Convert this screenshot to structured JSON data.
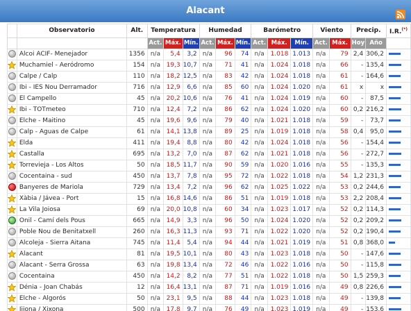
{
  "title": "Alacant",
  "headers": {
    "observatorio": "Observatorio",
    "alt": "Alt.",
    "temperatura": "Temperatura",
    "humedad": "Humedad",
    "barometro": "Barómetro",
    "viento": "Viento",
    "precip": "Precip.",
    "ir": "I.R.",
    "ir_sup": "(*)",
    "act": "Act.",
    "max": "Máx.",
    "min": "Mín.",
    "hoy": "Hoy",
    "ano": "Año"
  },
  "colors": {
    "max": "#d21f1f",
    "min": "#1f3fb5",
    "bar": "#2f66c8",
    "header": "#3a79c4"
  },
  "rows": [
    {
      "icon": "gray",
      "name": "Alcoi ACIF- Menejador",
      "alt": "1356",
      "t_act": "n/a",
      "t_max": "5,4",
      "t_min": "3,2",
      "h_act": "n/a",
      "h_max": "96",
      "h_min": "74",
      "b_act": "n/a",
      "b_max": "1.018",
      "b_min": "1.013",
      "v_act": "n/a",
      "v_max": "79",
      "p_hoy": "2,4",
      "p_ano": "306,2",
      "ir": 0.55
    },
    {
      "icon": "star",
      "name": "Muchamiel - Aeródromo",
      "alt": "154",
      "t_act": "n/a",
      "t_max": "19,3",
      "t_min": "10,7",
      "h_act": "n/a",
      "h_max": "71",
      "h_min": "41",
      "b_act": "n/a",
      "b_max": "1.024",
      "b_min": "1.018",
      "v_act": "n/a",
      "v_max": "66",
      "p_hoy": "-",
      "p_ano": "135,4",
      "ir": 0.6
    },
    {
      "icon": "gray",
      "name": "Calpe / Calp",
      "alt": "110",
      "t_act": "n/a",
      "t_max": "18,2",
      "t_min": "12,5",
      "h_act": "n/a",
      "h_max": "83",
      "h_min": "42",
      "b_act": "n/a",
      "b_max": "1.024",
      "b_min": "1.018",
      "v_act": "n/a",
      "v_max": "61",
      "p_hoy": "-",
      "p_ano": "164,6",
      "ir": 0.55
    },
    {
      "icon": "gray",
      "name": "Ibi - IES Nou Derramador",
      "alt": "716",
      "t_act": "n/a",
      "t_max": "12,9",
      "t_min": "6,6",
      "h_act": "n/a",
      "h_max": "85",
      "h_min": "60",
      "b_act": "n/a",
      "b_max": "1.024",
      "b_min": "1.020",
      "v_act": "n/a",
      "v_max": "61",
      "p_hoy": "x",
      "p_ano": "x",
      "ir": 0.6
    },
    {
      "icon": "gray",
      "name": "El Campello",
      "alt": "45",
      "t_act": "n/a",
      "t_max": "20,2",
      "t_min": "10,6",
      "h_act": "n/a",
      "h_max": "76",
      "h_min": "41",
      "b_act": "n/a",
      "b_max": "1.024",
      "b_min": "1.019",
      "v_act": "n/a",
      "v_max": "60",
      "p_hoy": "-",
      "p_ano": "87,5",
      "ir": 0.55
    },
    {
      "icon": "star",
      "name": "Ibi - TOTmeteo",
      "alt": "710",
      "t_act": "n/a",
      "t_max": "12,4",
      "t_min": "7,2",
      "h_act": "n/a",
      "h_max": "86",
      "h_min": "62",
      "b_act": "n/a",
      "b_max": "1.024",
      "b_min": "1.020",
      "v_act": "n/a",
      "v_max": "60",
      "p_hoy": "0,2",
      "p_ano": "216,2",
      "ir": 0.6
    },
    {
      "icon": "gray",
      "name": "Elche - Maitino",
      "alt": "45",
      "t_act": "n/a",
      "t_max": "19,6",
      "t_min": "9,6",
      "h_act": "n/a",
      "h_max": "79",
      "h_min": "40",
      "b_act": "n/a",
      "b_max": "1.021",
      "b_min": "1.018",
      "v_act": "n/a",
      "v_max": "59",
      "p_hoy": "-",
      "p_ano": "73,7",
      "ir": 0.55
    },
    {
      "icon": "gray",
      "name": "Calp - Aguas de Calpe",
      "alt": "61",
      "t_act": "n/a",
      "t_max": "14,1",
      "t_min": "13,8",
      "h_act": "n/a",
      "h_max": "89",
      "h_min": "25",
      "b_act": "n/a",
      "b_max": "1.019",
      "b_min": "1.018",
      "v_act": "n/a",
      "v_max": "58",
      "p_hoy": "0,4",
      "p_ano": "95,0",
      "ir": 0.6
    },
    {
      "icon": "star",
      "name": "Elda",
      "alt": "411",
      "t_act": "n/a",
      "t_max": "19,4",
      "t_min": "8,8",
      "h_act": "n/a",
      "h_max": "80",
      "h_min": "42",
      "b_act": "n/a",
      "b_max": "1.024",
      "b_min": "1.018",
      "v_act": "n/a",
      "v_max": "56",
      "p_hoy": "-",
      "p_ano": "154,4",
      "ir": 0.55
    },
    {
      "icon": "star",
      "name": "Castalla",
      "alt": "695",
      "t_act": "n/a",
      "t_max": "13,2",
      "t_min": "7,0",
      "h_act": "n/a",
      "h_max": "87",
      "h_min": "62",
      "b_act": "n/a",
      "b_max": "1.021",
      "b_min": "1.018",
      "v_act": "n/a",
      "v_max": "56",
      "p_hoy": "-",
      "p_ano": "272,7",
      "ir": 0.6
    },
    {
      "icon": "star",
      "name": "Torrevieja - Los Altos",
      "alt": "50",
      "t_act": "n/a",
      "t_max": "18,5",
      "t_min": "11,7",
      "h_act": "n/a",
      "h_max": "90",
      "h_min": "59",
      "b_act": "n/a",
      "b_max": "1.020",
      "b_min": "1.016",
      "v_act": "n/a",
      "v_max": "55",
      "p_hoy": "-",
      "p_ano": "135,3",
      "ir": 0.55
    },
    {
      "icon": "gray",
      "name": "Cocentaina - sud",
      "alt": "450",
      "t_act": "n/a",
      "t_max": "13,7",
      "t_min": "7,8",
      "h_act": "n/a",
      "h_max": "95",
      "h_min": "72",
      "b_act": "n/a",
      "b_max": "1.022",
      "b_min": "1.018",
      "v_act": "n/a",
      "v_max": "54",
      "p_hoy": "1,2",
      "p_ano": "231,3",
      "ir": 0.6
    },
    {
      "icon": "red",
      "name": "Banyeres de Mariola",
      "alt": "729",
      "t_act": "n/a",
      "t_max": "13,4",
      "t_min": "7,2",
      "h_act": "n/a",
      "h_max": "96",
      "h_min": "62",
      "b_act": "n/a",
      "b_max": "1.025",
      "b_min": "1.022",
      "v_act": "n/a",
      "v_max": "53",
      "p_hoy": "0,2",
      "p_ano": "244,6",
      "ir": 0.55
    },
    {
      "icon": "star",
      "name": "Xàbia / Jávea - Port",
      "alt": "15",
      "t_act": "n/a",
      "t_max": "16,8",
      "t_min": "14,6",
      "h_act": "n/a",
      "h_max": "86",
      "h_min": "51",
      "b_act": "n/a",
      "b_max": "1.019",
      "b_min": "1.018",
      "v_act": "n/a",
      "v_max": "53",
      "p_hoy": "2,2",
      "p_ano": "208,4",
      "ir": 0.6
    },
    {
      "icon": "star",
      "name": "La Vila Joiosa",
      "alt": "69",
      "t_act": "n/a",
      "t_max": "20,0",
      "t_min": "10,8",
      "h_act": "n/a",
      "h_max": "60",
      "h_min": "34",
      "b_act": "n/a",
      "b_max": "1.023",
      "b_min": "1.017",
      "v_act": "n/a",
      "v_max": "52",
      "p_hoy": "0,2",
      "p_ano": "114,3",
      "ir": 0.55
    },
    {
      "icon": "green",
      "name": "Onil - Camí dels Pous",
      "alt": "665",
      "t_act": "n/a",
      "t_max": "14,9",
      "t_min": "3,3",
      "h_act": "n/a",
      "h_max": "96",
      "h_min": "50",
      "b_act": "n/a",
      "b_max": "1.024",
      "b_min": "1.020",
      "v_act": "n/a",
      "v_max": "52",
      "p_hoy": "0,2",
      "p_ano": "209,2",
      "ir": 0.6
    },
    {
      "icon": "gray",
      "name": "Poble Nou de Benitatxell",
      "alt": "260",
      "t_act": "n/a",
      "t_max": "16,3",
      "t_min": "11,3",
      "h_act": "n/a",
      "h_max": "93",
      "h_min": "71",
      "b_act": "n/a",
      "b_max": "1.022",
      "b_min": "1.020",
      "v_act": "n/a",
      "v_max": "52",
      "p_hoy": "0,2",
      "p_ano": "190,4",
      "ir": 0.55
    },
    {
      "icon": "gray",
      "name": "Alcoleja - Sierra Aitana",
      "alt": "745",
      "t_act": "n/a",
      "t_max": "11,4",
      "t_min": "5,4",
      "h_act": "n/a",
      "h_max": "94",
      "h_min": "44",
      "b_act": "n/a",
      "b_max": "1.021",
      "b_min": "1.019",
      "v_act": "n/a",
      "v_max": "51",
      "p_hoy": "0,8",
      "p_ano": "368,0",
      "ir": 0.3
    },
    {
      "icon": "star",
      "name": "Alacant",
      "alt": "81",
      "t_act": "n/a",
      "t_max": "19,5",
      "t_min": "10,1",
      "h_act": "n/a",
      "h_max": "80",
      "h_min": "43",
      "b_act": "n/a",
      "b_max": "1.023",
      "b_min": "1.018",
      "v_act": "n/a",
      "v_max": "50",
      "p_hoy": "-",
      "p_ano": "147,6",
      "ir": 0.55
    },
    {
      "icon": "gray",
      "name": "Alacant - Serra Grossa",
      "alt": "63",
      "t_act": "n/a",
      "t_max": "19,8",
      "t_min": "13,4",
      "h_act": "n/a",
      "h_max": "72",
      "h_min": "46",
      "b_act": "n/a",
      "b_max": "1.022",
      "b_min": "1.016",
      "v_act": "n/a",
      "v_max": "50",
      "p_hoy": "-",
      "p_ano": "115,8",
      "ir": 0.6
    },
    {
      "icon": "gray",
      "name": "Cocentaina",
      "alt": "450",
      "t_act": "n/a",
      "t_max": "14,2",
      "t_min": "8,2",
      "h_act": "n/a",
      "h_max": "77",
      "h_min": "51",
      "b_act": "n/a",
      "b_max": "1.022",
      "b_min": "1.018",
      "v_act": "n/a",
      "v_max": "50",
      "p_hoy": "1,5",
      "p_ano": "259,3",
      "ir": 0.55
    },
    {
      "icon": "star",
      "name": "Dénia - Joan Chabás",
      "alt": "12",
      "t_act": "n/a",
      "t_max": "16,4",
      "t_min": "13,1",
      "h_act": "n/a",
      "h_max": "87",
      "h_min": "71",
      "b_act": "n/a",
      "b_max": "1.019",
      "b_min": "1.016",
      "v_act": "n/a",
      "v_max": "49",
      "p_hoy": "0,8",
      "p_ano": "226,6",
      "ir": 0.6
    },
    {
      "icon": "star",
      "name": "Elche - Algorós",
      "alt": "50",
      "t_act": "n/a",
      "t_max": "23,1",
      "t_min": "9,5",
      "h_act": "n/a",
      "h_max": "88",
      "h_min": "44",
      "b_act": "n/a",
      "b_max": "1.023",
      "b_min": "1.018",
      "v_act": "n/a",
      "v_max": "49",
      "p_hoy": "-",
      "p_ano": "139,8",
      "ir": 0.55
    },
    {
      "icon": "star",
      "name": "Jijona / Xixona",
      "alt": "500",
      "t_act": "n/a",
      "t_max": "17,8",
      "t_min": "9,7",
      "h_act": "n/a",
      "h_max": "76",
      "h_min": "49",
      "b_act": "n/a",
      "b_max": "1.023",
      "b_min": "1.019",
      "v_act": "n/a",
      "v_max": "49",
      "p_hoy": "-",
      "p_ano": "153,6",
      "ir": 0.6
    }
  ]
}
